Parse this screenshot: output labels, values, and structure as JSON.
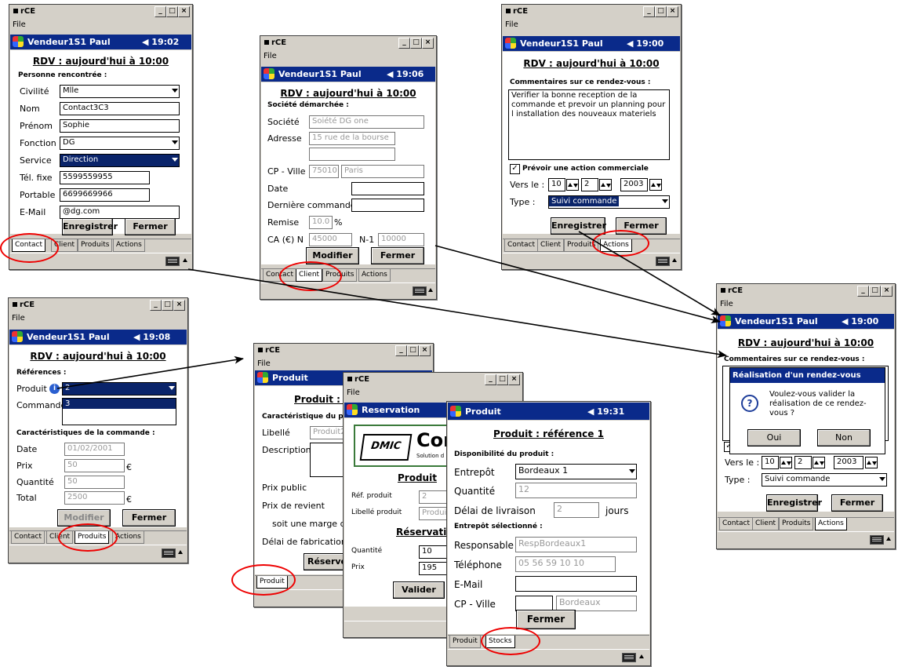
{
  "common": {
    "app_title": "rCE",
    "menu_file": "File",
    "user": "Vendeur1S1 Paul",
    "rdv_title": "RDV : aujourd'hui à 10:00",
    "save": "Enregistrer",
    "close": "Fermer",
    "modify": "Modifier",
    "tab_contact": "Contact",
    "tab_client": "Client",
    "tab_produits": "Produits",
    "tab_actions": "Actions"
  },
  "win_contact": {
    "time": "19:02",
    "section": "Personne rencontrée :",
    "labels": [
      "Civilité",
      "Nom",
      "Prénom",
      "Fonction",
      "Service",
      "Tél. fixe",
      "Portable",
      "E-Mail"
    ],
    "values": [
      "Mlle",
      "Contact3C3",
      "Sophie",
      "DG",
      "Direction",
      "5599559955",
      "6699669966",
      "@dg.com"
    ]
  },
  "win_client": {
    "time": "19:06",
    "section": "Société démarchée :",
    "labels": [
      "Société",
      "Adresse",
      "CP - Ville",
      "Date",
      "Dernière commande",
      "Remise",
      "CA (€) N",
      "N-1"
    ],
    "societe": "Soiété DG one",
    "adresse": "15 rue de la bourse",
    "cp": "75010",
    "ville": "Paris",
    "remise": "10.0",
    "percent": "%",
    "ca_n": "45000",
    "ca_n1": "10000"
  },
  "win_actions": {
    "time": "19:00",
    "section": "Commentaires sur ce rendez-vous :",
    "comment": "Verifier la bonne reception de la commande et prevoir un planning pour l installation des nouveaux materiels",
    "check_label": "Prévoir une action commerciale",
    "vers_label": "Vers le :",
    "day": "10",
    "month": "2",
    "year": "2003",
    "type_label": "Type :",
    "type_value": "Suivi commande"
  },
  "win_confirm": {
    "time": "19:00",
    "section": "Commentaires sur ce rendez-vous :",
    "dialog_title": "Réalisation d'un rendez-vous",
    "dialog_text": "Voulez-vous valider la réalisation de ce rendez-vous ?",
    "yes": "Oui",
    "no": "Non",
    "vers_label": "Vers le :",
    "day": "10",
    "month": "2",
    "year": "2003",
    "type_label": "Type :",
    "type_value": "Suivi commande"
  },
  "win_produits": {
    "time": "19:08",
    "section_ref": "Références :",
    "produit_label": "Produit",
    "produit_value": "2",
    "commande_label": "Commande",
    "commande_value": "3",
    "section_car": "Caractéristiques de la commande :",
    "labels": [
      "Date",
      "Prix",
      "Quantité",
      "Total"
    ],
    "values": [
      "01/02/2001",
      "50",
      "50",
      "2500"
    ],
    "euro": "€"
  },
  "win_produit1": {
    "title": "Produit",
    "heading": "Produit : r",
    "section": "Caractéristique du pro",
    "labels": [
      "Libellé",
      "Description",
      "Prix public",
      "Prix de revient",
      "soit une marge d",
      "Délai de fabrication"
    ],
    "libelle": "Produit2",
    "reserve": "Réserve",
    "tab": "Produit"
  },
  "win_reservation": {
    "title": "Reservation",
    "logo": "DMIC",
    "logo_text": "Con",
    "logo_sub": "Solution d",
    "produit_heading": "Produit",
    "ref_label": "Réf. produit",
    "ref_value": "2",
    "lib_label": "Libellé produit",
    "lib_value": "Produi",
    "res_heading": "Réservatio",
    "qte_label": "Quantité",
    "qte_value": "10",
    "prix_label": "Prix",
    "prix_value": "195",
    "valider": "Valider"
  },
  "win_stocks": {
    "title": "Produit",
    "time": "19:31",
    "heading": "Produit : référence 1",
    "section_dispo": "Disponibilité du produit :",
    "entrepot_label": "Entrepôt",
    "entrepot_value": "Bordeaux 1",
    "qte_label": "Quantité",
    "qte_value": "12",
    "delai_label": "Délai de livraison",
    "delai_value": "2",
    "delai_unit": "jours",
    "section_sel": "Entrepôt sélectionné :",
    "resp_label": "Responsable",
    "resp_value": "RespBordeaux1",
    "tel_label": "Téléphone",
    "tel_value": "05 56 59 10 10",
    "email_label": "E-Mail",
    "cp_label": "CP - Ville",
    "ville_value": "Bordeaux",
    "tab_produit": "Produit",
    "tab_stocks": "Stocks"
  }
}
